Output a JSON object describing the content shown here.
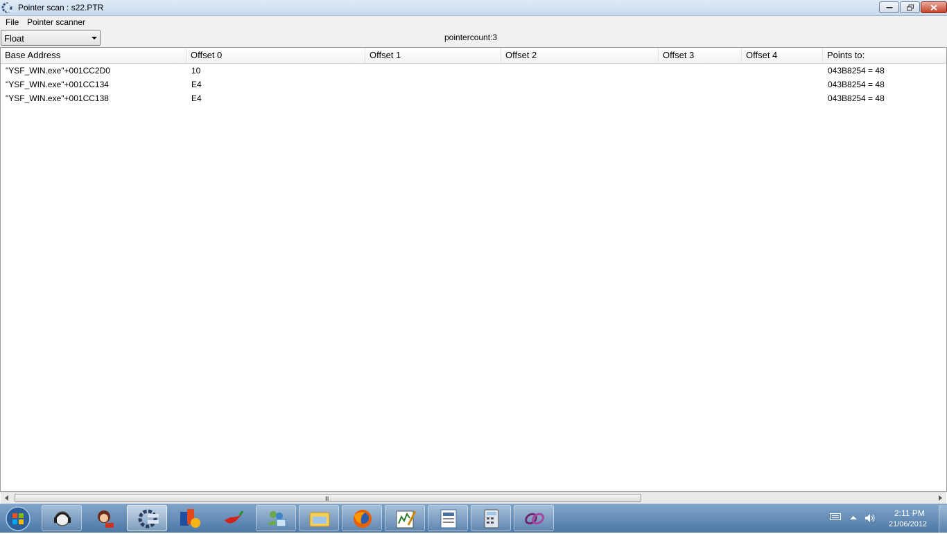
{
  "window": {
    "title": "Pointer scan : s22.PTR",
    "app_icon": "cheat-engine-icon",
    "controls": [
      "minimize-icon",
      "restore-icon",
      "close-icon"
    ]
  },
  "menu": {
    "items": [
      {
        "label": "File"
      },
      {
        "label": "Pointer scanner"
      }
    ]
  },
  "toolbar": {
    "type_select": {
      "value": "Float",
      "icon": "chevron-down-icon"
    },
    "pointercount": "pointercount:3"
  },
  "table": {
    "columns": [
      "Base Address",
      "Offset 0",
      "Offset 1",
      "Offset 2",
      "Offset 3",
      "Offset 4",
      "Points to:"
    ],
    "rows": [
      [
        "\"YSF_WIN.exe\"+001CC2D0",
        "10",
        "",
        "",
        "",
        "",
        "043B8254 = 48"
      ],
      [
        "\"YSF_WIN.exe\"+001CC134",
        "E4",
        "",
        "",
        "",
        "",
        "043B8254 = 48"
      ],
      [
        "\"YSF_WIN.exe\"+001CC138",
        "E4",
        "",
        "",
        "",
        "",
        "043B8254 = 48"
      ]
    ]
  },
  "scrollbar": {
    "grip": "III"
  },
  "taskbar": {
    "start_icon": "windows-start-icon",
    "apps": [
      {
        "name": "headset-support-icon",
        "state": "pinned"
      },
      {
        "name": "woman-game-icon",
        "state": "none"
      },
      {
        "name": "cheat-engine-icon",
        "state": "active"
      },
      {
        "name": "media-player-icon",
        "state": "none"
      },
      {
        "name": "chili-pepper-icon",
        "state": "none"
      },
      {
        "name": "users-network-icon",
        "state": "pinned"
      },
      {
        "name": "file-explorer-icon",
        "state": "pinned"
      },
      {
        "name": "firefox-icon",
        "state": "pinned"
      },
      {
        "name": "chart-editor-icon",
        "state": "pinned"
      },
      {
        "name": "text-document-icon",
        "state": "pinned"
      },
      {
        "name": "calculator-icon",
        "state": "pinned"
      },
      {
        "name": "link-tool-icon",
        "state": "pinned"
      }
    ],
    "tray": [
      "keyboard-icon",
      "show-hidden-icons-icon",
      "volume-icon"
    ],
    "clock": {
      "time": "2:11 PM",
      "date": "21/06/2012"
    }
  },
  "colors": {
    "accent": "#4d78a6",
    "title_bar": "#dfeaf7",
    "close_button": "#c8442a"
  }
}
